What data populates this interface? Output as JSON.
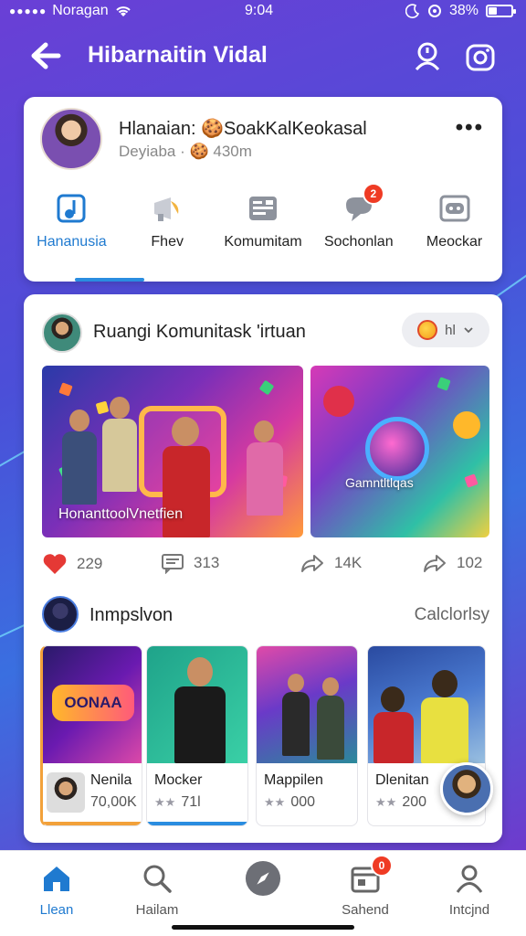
{
  "status_bar": {
    "carrier": "Noragan",
    "time": "9:04",
    "battery": "38%",
    "battery_level": 0.38
  },
  "header": {
    "title": "Hibarnaitin Vidal",
    "back_icon": "arrow-left-icon",
    "right_icons": [
      "profile-alert-icon",
      "camera-icon"
    ]
  },
  "profile": {
    "name": "Hlanaian: 🍪SoakKalKeokasal",
    "subtitle": "Deyiaba · 🍪 430m",
    "more_label": "•••",
    "tabs": [
      {
        "label": "Hananusia",
        "icon": "music-note-icon",
        "active": true
      },
      {
        "label": "Fhev",
        "icon": "megaphone-icon",
        "active": false
      },
      {
        "label": "Komumitam",
        "icon": "list-card-icon",
        "active": false
      },
      {
        "label": "Sochonlan",
        "icon": "chat-bubble-icon",
        "active": false,
        "badge": "2"
      },
      {
        "label": "Meockar",
        "icon": "game-controller-icon",
        "active": false
      }
    ]
  },
  "post": {
    "title": "Ruangi Komunitask 'irtuan",
    "lang_pill": "hl",
    "media": [
      {
        "caption": "HonanttoolVnetfien"
      },
      {
        "caption": "Gamntltlqas"
      }
    ],
    "reactions": [
      {
        "icon": "heart-icon",
        "count": "229"
      },
      {
        "icon": "comment-icon",
        "count": "313"
      },
      {
        "icon": "share-icon",
        "count": "14K"
      },
      {
        "icon": "forward-icon",
        "count": "102"
      }
    ]
  },
  "section": {
    "title": "Inmpslvon",
    "link": "Calclorlsy",
    "items": [
      {
        "name": "Nenila",
        "meta": "70,00K",
        "badge_text": "OONAA"
      },
      {
        "name": "Mocker",
        "meta": "71l",
        "stars": "★★"
      },
      {
        "name": "Mappilen",
        "meta": "000",
        "stars": "★★"
      },
      {
        "name": "Dlenitan",
        "meta": "200",
        "stars": "★★"
      }
    ]
  },
  "bottom_nav": [
    {
      "label": "Llean",
      "icon": "home-icon",
      "active": true
    },
    {
      "label": "Hailam",
      "icon": "search-icon",
      "active": false
    },
    {
      "label": "",
      "icon": "compass-icon",
      "active": false
    },
    {
      "label": "Sahend",
      "icon": "calendar-icon",
      "active": false,
      "badge": "0"
    },
    {
      "label": "Intcjnd",
      "icon": "person-icon",
      "active": false
    }
  ],
  "colors": {
    "accent": "#1f7ad0",
    "badge": "#ef3b24",
    "heart": "#e53935"
  }
}
